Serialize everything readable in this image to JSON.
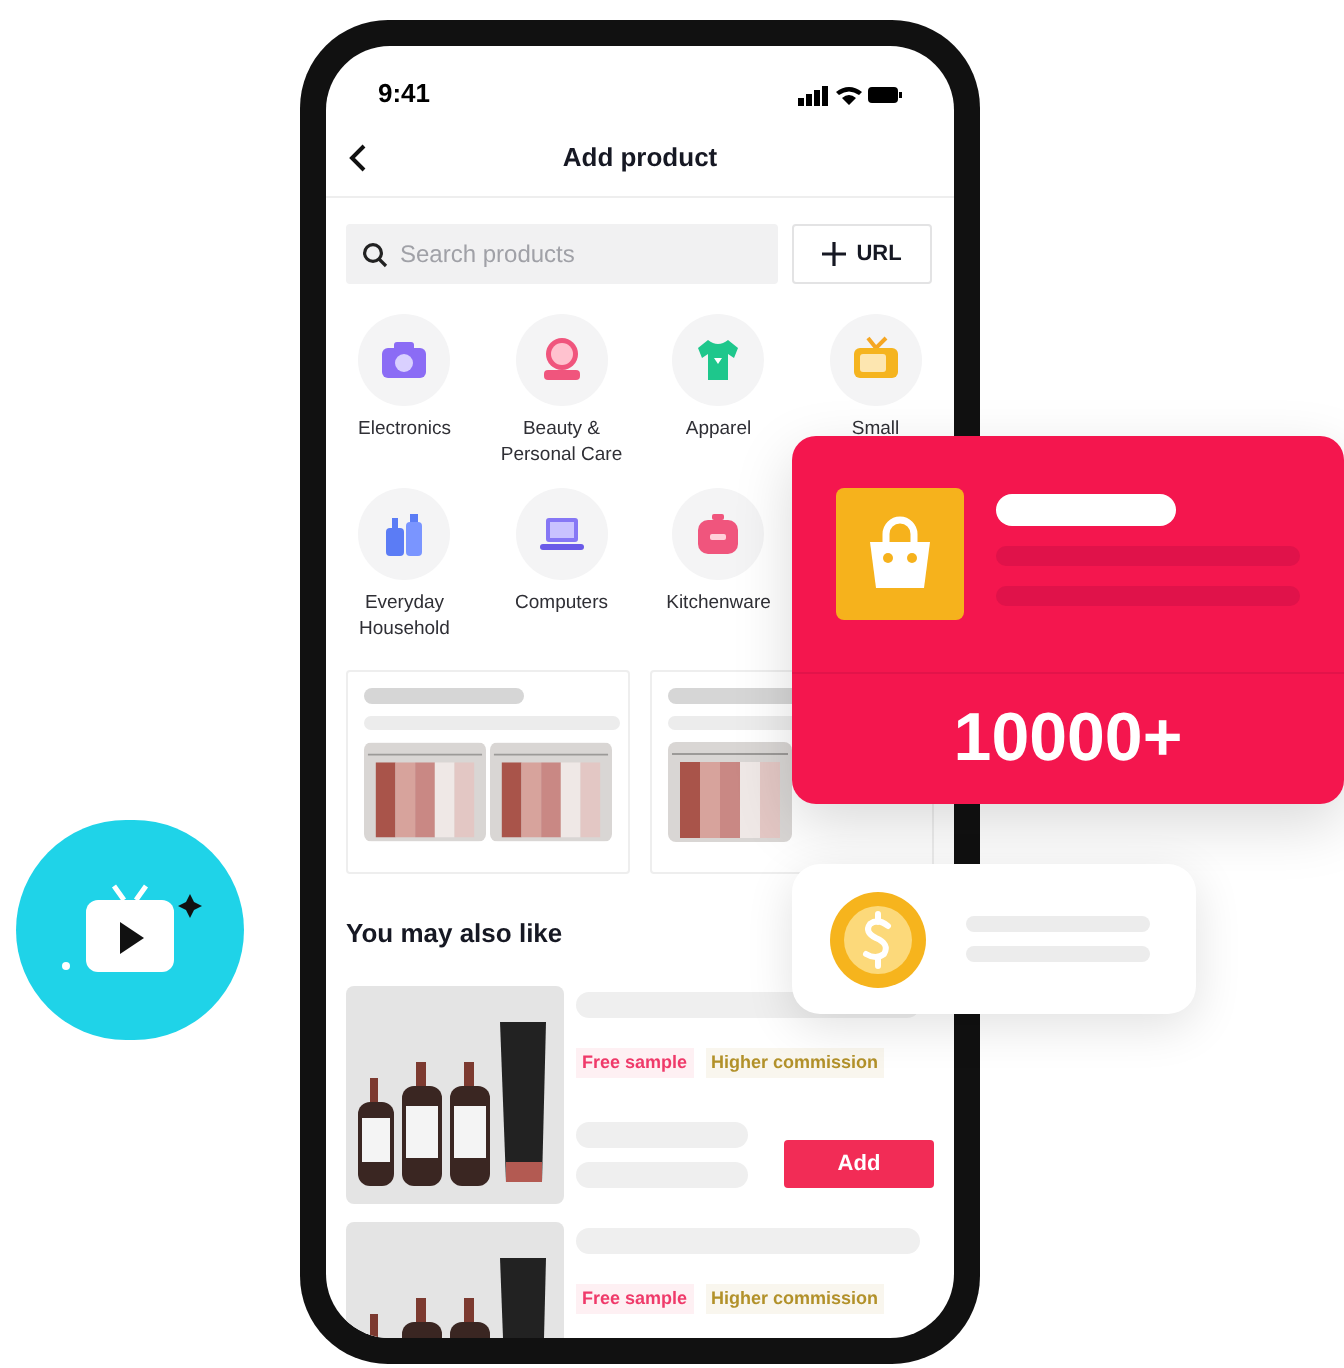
{
  "status_bar": {
    "time": "9:41"
  },
  "header": {
    "title": "Add product"
  },
  "search": {
    "placeholder": "Search products"
  },
  "url_button": {
    "label": "URL"
  },
  "categories": [
    {
      "label": "Electronics"
    },
    {
      "label": "Beauty & Personal Care"
    },
    {
      "label": "Apparel"
    },
    {
      "label": "Small"
    },
    {
      "label": "Everyday Household"
    },
    {
      "label": "Computers"
    },
    {
      "label": "Kitchenware"
    }
  ],
  "section_title": "You may also like",
  "products": [
    {
      "tags": [
        {
          "label": "Free sample",
          "color": "#ef3a6a"
        },
        {
          "label": "Higher commission",
          "color": "#b2912a"
        }
      ],
      "add_button": "Add"
    },
    {
      "tags": [
        {
          "label": "Free sample",
          "color": "#ef3a6a"
        },
        {
          "label": "Higher commission",
          "color": "#b2912a"
        }
      ]
    }
  ],
  "promo_card": {
    "count": "10000+"
  }
}
